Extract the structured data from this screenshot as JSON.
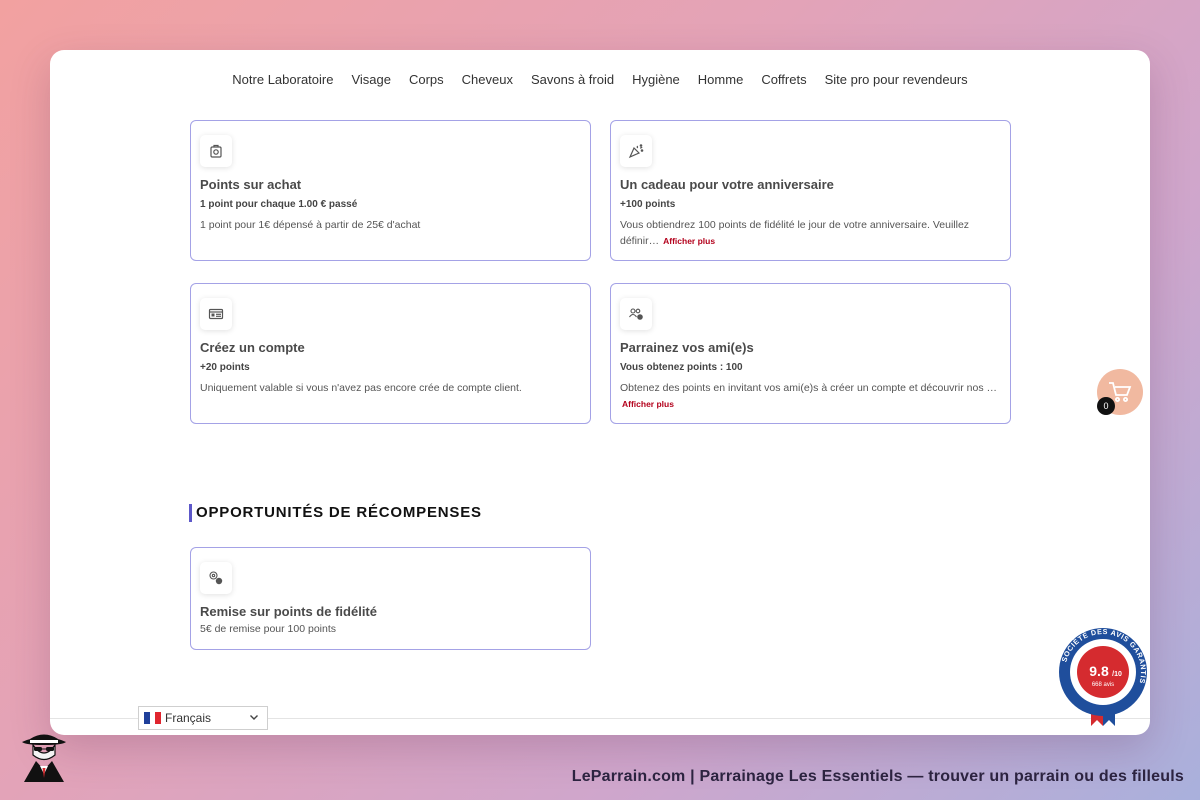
{
  "nav": {
    "items": [
      "Notre Laboratoire",
      "Visage",
      "Corps",
      "Cheveux",
      "Savons à froid",
      "Hygiène",
      "Homme",
      "Coffrets",
      "Site pro pour revendeurs"
    ]
  },
  "earn_cards": [
    {
      "icon": "shopping-bag-icon",
      "title": "Points sur achat",
      "sub": "1 point pour chaque 1.00 € passé",
      "desc": "1 point pour 1€ dépensé à partir de 25€ d'achat",
      "more": ""
    },
    {
      "icon": "party-popper-icon",
      "title": "Un cadeau pour votre anniversaire",
      "sub": "+100 points",
      "desc": "Vous obtiendrez 100 points de fidélité le jour de votre anniversaire. Veuillez définir…",
      "more": "Afficher plus"
    },
    {
      "icon": "id-card-icon",
      "title": "Créez un compte",
      "sub": "+20 points",
      "desc": "Uniquement valable si vous n'avez pas encore crée de compte client.",
      "more": ""
    },
    {
      "icon": "referral-users-icon",
      "title": "Parrainez vos ami(e)s",
      "sub": "Vous obtenez points : 100",
      "desc": "Obtenez des points en invitant vos ami(e)s à créer un compte et découvrir nos …",
      "more": "Afficher plus"
    }
  ],
  "rewards_section": {
    "title": "OPPORTUNITÉS DE RÉCOMPENSES",
    "card": {
      "icon": "discount-coin-icon",
      "title": "Remise sur points de fidélité",
      "desc": "5€ de remise pour 100 points"
    }
  },
  "language": {
    "selected": "Français"
  },
  "cart": {
    "count": "0"
  },
  "rating_badge": {
    "ring_text": "SOCIÉTÉ DES AVIS GARANTIS",
    "score": "9.8",
    "scale": "/10",
    "reviews": "668 avis"
  },
  "caption": "LeParrain.com | Parrainage Les Essentiels — trouver un parrain ou des filleuls",
  "colors": {
    "card_border": "#a4a2e6",
    "section_accent": "#5d58c9",
    "more_link": "#b3001b",
    "cart_bg": "#f1b9a0",
    "badge_blue": "#1f4e9c",
    "badge_red": "#d52b2f"
  }
}
